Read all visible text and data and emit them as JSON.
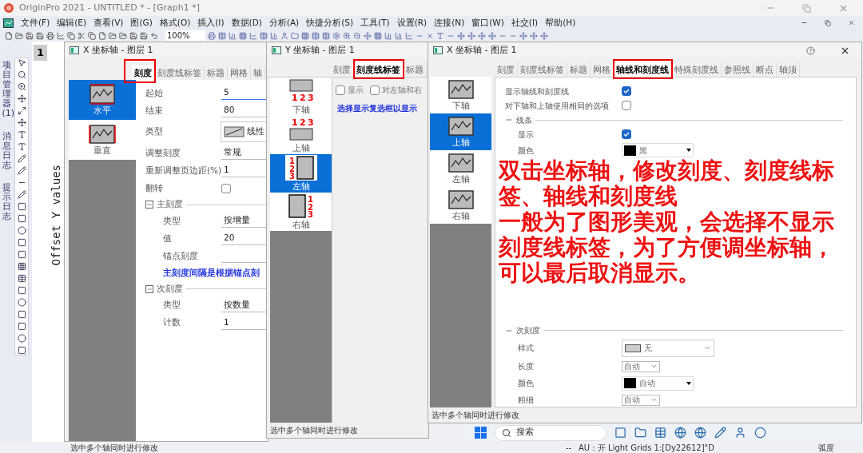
{
  "app": {
    "title": "OriginPro 2021 - UNTITLED * - [Graph1 *]"
  },
  "menu": [
    "文件(F)",
    "编辑(E)",
    "查看(V)",
    "图(G)",
    "格式(O)",
    "插入(I)",
    "数据(D)",
    "分析(A)",
    "快捷分析(S)",
    "工具(T)",
    "设置(R)",
    "连接(N)",
    "窗口(W)",
    "社交(I)",
    "帮助(H)"
  ],
  "toolbar": {
    "zoom": "100%"
  },
  "side_tabs": [
    "项目管理器 (1)",
    "消息日志",
    "提示日志"
  ],
  "graph": {
    "layer": "1",
    "ylabel": "Offset Y values"
  },
  "x_scale_dialog": {
    "title": "X 坐标轴 - 图层 1",
    "tabs": [
      {
        "label": "刻度",
        "selected": true
      },
      {
        "label": "刻度线标签",
        "selected": false
      },
      {
        "label": "标题",
        "selected": false
      },
      {
        "label": "网格",
        "selected": false
      },
      {
        "label": "轴",
        "selected": false
      }
    ],
    "axes": [
      {
        "label": "水平",
        "kind": "horizontal",
        "selected": true
      },
      {
        "label": "垂直",
        "kind": "vertical",
        "selected": false
      }
    ],
    "rows": [
      {
        "kind": "input",
        "label": "起始",
        "value": "5"
      },
      {
        "kind": "input",
        "label": "结束",
        "value": "80"
      },
      {
        "kind": "type",
        "label": "类型",
        "value": "线性"
      },
      {
        "kind": "input",
        "label": "调整刻度",
        "value": "常规"
      },
      {
        "kind": "input",
        "label": "重新调整页边距(%)",
        "value": "1"
      },
      {
        "kind": "check",
        "label": "翻转",
        "checked": false
      }
    ],
    "major": {
      "title": "主刻度",
      "rows": [
        {
          "label": "类型",
          "value": "按增量"
        },
        {
          "label": "值",
          "value": "20"
        },
        {
          "label": "锚点刻度",
          "value": ""
        }
      ],
      "note": "主刻度间隔是根据锚点刻"
    },
    "minor": {
      "title": "次刻度",
      "rows": [
        {
          "label": "类型",
          "value": "按数量"
        },
        {
          "label": "计数",
          "value": "1"
        }
      ]
    }
  },
  "y_labels_dialog": {
    "title": "Y 坐标轴 - 图层 1",
    "tabs": [
      {
        "label": "刻度",
        "selected": false
      },
      {
        "label": "刻度线标签",
        "selected": true
      },
      {
        "label": "标题",
        "selected": false
      }
    ],
    "axes": [
      {
        "label": "下轴",
        "kind": "bottom",
        "selected": false,
        "digits": [
          "1",
          "2",
          "3"
        ]
      },
      {
        "label": "上轴",
        "kind": "top",
        "selected": false,
        "digits": [
          "1",
          "2",
          "3"
        ]
      },
      {
        "label": "左轴",
        "kind": "left",
        "selected": true,
        "digits": [
          "1",
          "2",
          "3"
        ]
      },
      {
        "label": "右轴",
        "kind": "right",
        "selected": false,
        "digits": [
          "1",
          "2",
          "3"
        ]
      }
    ],
    "checks": [
      {
        "label": "显示",
        "checked": false
      },
      {
        "label": "对左轴和右",
        "checked": false
      }
    ],
    "note": "选择显示复选框以显示",
    "footer": "选中多个轴同时进行修改"
  },
  "x_line_dialog": {
    "title": "X 坐标轴 - 图层 1",
    "tabs": [
      {
        "label": "刻度",
        "selected": false
      },
      {
        "label": "刻度线标签",
        "selected": false
      },
      {
        "label": "标题",
        "selected": false
      },
      {
        "label": "网格",
        "selected": false
      },
      {
        "label": "轴线和刻度线",
        "selected": true
      },
      {
        "label": "特殊刻度线",
        "selected": false
      },
      {
        "label": "参照线",
        "selected": false
      },
      {
        "label": "断点",
        "selected": false
      },
      {
        "label": "轴须",
        "selected": false
      }
    ],
    "axes": [
      {
        "label": "下轴",
        "selected": false
      },
      {
        "label": "上轴",
        "selected": true
      },
      {
        "label": "左轴",
        "selected": false
      },
      {
        "label": "右轴",
        "selected": false
      }
    ],
    "top_checks": [
      {
        "label": "显示轴线和刻度线",
        "checked": true
      },
      {
        "label": "对下轴和上轴使用相同的选项",
        "checked": false
      }
    ],
    "line": {
      "title": "线条",
      "show": {
        "label": "显示",
        "checked": true
      },
      "color": {
        "label": "颜色",
        "value": "黑",
        "color": "#000000"
      }
    },
    "minor": {
      "title": "次刻度",
      "rows": [
        {
          "kind": "style",
          "label": "样式",
          "value": "无"
        },
        {
          "kind": "select",
          "label": "长度",
          "value": "自动"
        },
        {
          "kind": "color",
          "label": "颜色",
          "value": "自动",
          "color": "#000000"
        },
        {
          "kind": "select",
          "label": "粗细",
          "value": "自动"
        }
      ]
    },
    "footer": "选中多个轴同时进行修改"
  },
  "annotation": [
    "双击坐标轴，修改刻度、刻度线标签、轴线和刻度线",
    "一般为了图形美观，会选择不显示刻度线标签，为了方便调坐标轴，可以最后取消显示。"
  ],
  "status_bar": {
    "message": "选中多个轴同时进行修改",
    "separator": "--",
    "info": "AU : 开 Light Grids 1:[Dy22612]\"D",
    "units": "弧度"
  },
  "taskbar": {
    "search": "搜索"
  }
}
